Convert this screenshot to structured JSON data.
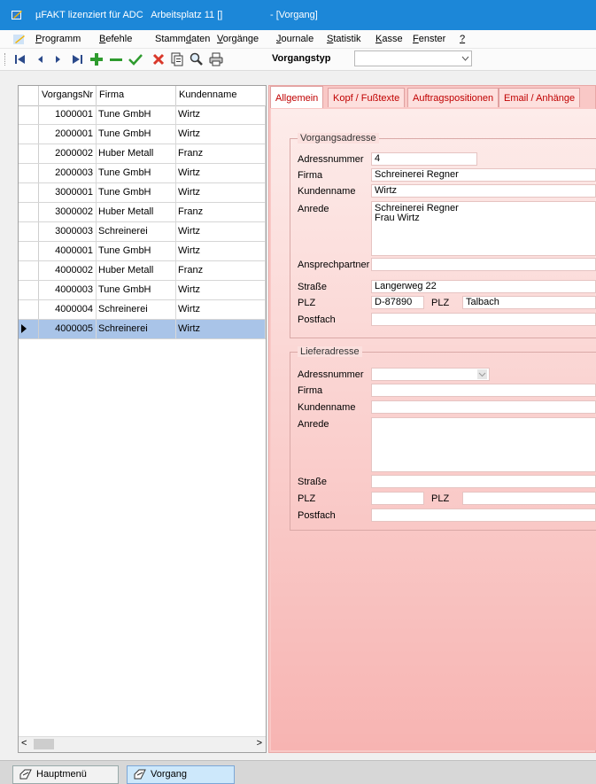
{
  "window": {
    "title": "µFAKT lizenziert für ADC   Arbeitsplatz 11 []",
    "subtitle": "- [Vorgang]"
  },
  "menu": {
    "items": [
      {
        "pre": "",
        "u": "P",
        "post": "rogramm"
      },
      {
        "pre": "",
        "u": "B",
        "post": "efehle"
      },
      {
        "pre": "Stamm",
        "u": "d",
        "post": "aten"
      },
      {
        "pre": "",
        "u": "V",
        "post": "orgänge"
      },
      {
        "pre": "",
        "u": "J",
        "post": "ournale"
      },
      {
        "pre": "",
        "u": "S",
        "post": "tatistik"
      },
      {
        "pre": "",
        "u": "K",
        "post": "asse"
      },
      {
        "pre": "",
        "u": "F",
        "post": "enster"
      },
      {
        "pre": "",
        "u": "?",
        "post": ""
      }
    ]
  },
  "toolbar": {
    "vorgangstyp_label": "Vorgangstyp",
    "vorgangstyp_value": ""
  },
  "grid": {
    "columns": [
      "VorgangsNr",
      "Firma",
      "Kundenname"
    ],
    "rows": [
      {
        "nr": "1000001",
        "firma": "Tune GmbH",
        "kunde": "Wirtz"
      },
      {
        "nr": "2000001",
        "firma": "Tune GmbH",
        "kunde": "Wirtz"
      },
      {
        "nr": "2000002",
        "firma": "Huber Metall",
        "kunde": "Franz"
      },
      {
        "nr": "2000003",
        "firma": "Tune GmbH",
        "kunde": "Wirtz"
      },
      {
        "nr": "3000001",
        "firma": "Tune GmbH",
        "kunde": "Wirtz"
      },
      {
        "nr": "3000002",
        "firma": "Huber Metall",
        "kunde": "Franz"
      },
      {
        "nr": "3000003",
        "firma": "Schreinerei",
        "kunde": "Wirtz"
      },
      {
        "nr": "4000001",
        "firma": "Tune GmbH",
        "kunde": "Wirtz"
      },
      {
        "nr": "4000002",
        "firma": "Huber Metall",
        "kunde": "Franz"
      },
      {
        "nr": "4000003",
        "firma": "Tune GmbH",
        "kunde": "Wirtz"
      },
      {
        "nr": "4000004",
        "firma": "Schreinerei",
        "kunde": "Wirtz"
      },
      {
        "nr": "4000005",
        "firma": "Schreinerei",
        "kunde": "Wirtz"
      }
    ],
    "selected_index": 11
  },
  "tabs": [
    "Allgemein",
    "Kopf / Fußtexte",
    "Auftragspositionen",
    "Email / Anhänge"
  ],
  "vorgangsadresse": {
    "title": "Vorgangsadresse",
    "labels": {
      "adressnummer": "Adressnummer",
      "firma": "Firma",
      "kundenname": "Kundenname",
      "anrede": "Anrede",
      "ansprechpartner": "Ansprechpartner",
      "strasse": "Straße",
      "plz": "PLZ",
      "plz2": "PLZ",
      "postfach": "Postfach"
    },
    "values": {
      "adressnummer": "4",
      "firma": "Schreinerei Regner",
      "kundenname": "Wirtz",
      "anrede": "Schreinerei Regner\nFrau Wirtz",
      "ansprechpartner": "",
      "strasse": "Langerweg 22",
      "plz": "D-87890",
      "ort": "Talbach",
      "postfach": ""
    }
  },
  "lieferadresse": {
    "title": "Lieferadresse",
    "labels": {
      "adressnummer": "Adressnummer",
      "firma": "Firma",
      "kundenname": "Kundenname",
      "anrede": "Anrede",
      "strasse": "Straße",
      "plz": "PLZ",
      "plz2": "PLZ",
      "postfach": "Postfach"
    },
    "values": {
      "adressnummer": "",
      "firma": "",
      "kundenname": "",
      "anrede": "",
      "strasse": "",
      "plz": "",
      "ort": "",
      "postfach": ""
    }
  },
  "taskbar": {
    "items": [
      "Hauptmenü",
      "Vorgang"
    ]
  },
  "colors": {
    "titlebar": "#1c87d8",
    "selection": "#a9c4e8",
    "panel": "#f9c8c6",
    "tab_text": "#c00000"
  }
}
